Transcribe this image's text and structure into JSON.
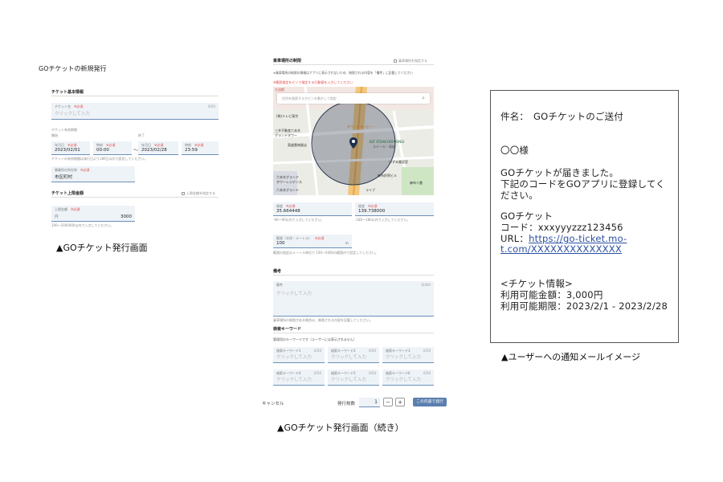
{
  "left": {
    "title": "GOチケットの新規発行",
    "basic_section": "チケット基本情報",
    "ticket_name": {
      "label": "チケット名",
      "required": "※必須",
      "placeholder": "クリックして入力",
      "count": "0/50"
    },
    "period_label": "チケット有効期間",
    "start_label": "開始",
    "end_label": "終了",
    "start_date": {
      "label": "年月日",
      "required": "※必須",
      "value": "2023/02/01"
    },
    "start_time": {
      "label": "時刻",
      "required": "※必須",
      "value": "00:00"
    },
    "tilde": "〜",
    "end_date": {
      "label": "年月日",
      "required": "※必須",
      "value": "2023/02/28"
    },
    "end_time": {
      "label": "時刻",
      "required": "※必須",
      "value": "23:59"
    },
    "period_hint": "チケットの有効期間は発行日より180日以内で設定してください。",
    "municipality": {
      "label": "事業所の所在地",
      "required": "※必須",
      "value": "市区町村"
    },
    "limit_section": "チケット上限金額",
    "limit_link": "上限金額を指定する",
    "limit_amount": {
      "label": "上限金額",
      "required": "※必須",
      "unit": "円",
      "value": "3000"
    },
    "limit_hint": "100〜1000000以内で入力してください。",
    "caption": "▲GOチケット発行画面"
  },
  "middle": {
    "area_section": "乗車場所の制限",
    "area_link": "乗車場所を指定する",
    "area_note": "※乗車場所の制限の情報はアプリに表示されないため、制限される内容を「備考」に記載してください",
    "map_hint": "※範囲指定をピンで指定する行動値を入力してください",
    "map_search_placeholder": "住所を検索するかピンを動かして指定",
    "map_labels": [
      "(株)テレビ東京",
      "タリーズコーヒー",
      "三井不動産六本木",
      "グランドタワー",
      "東盛雲南飯店",
      "BLT STEAK ROPPONGI",
      "ステーキ・高級",
      "六本木グランド",
      "タワーレジデンス",
      "いずみ美容室",
      "麻布十番",
      "麻布鈴寄ビル",
      "ライブ",
      "六本木グランド"
    ],
    "map_brand": "大治郎",
    "latitude": {
      "label": "緯度",
      "required": "※必須",
      "value": "35.664448"
    },
    "longitude": {
      "label": "経度",
      "required": "※必須",
      "value": "139.738000"
    },
    "lat_hint": "-90〜90以内で入力してください。",
    "lng_hint": "-180〜180以内で入力してください。",
    "radius": {
      "label": "範囲（半径・メートル）",
      "required": "※必須",
      "value": "100",
      "unit": "m"
    },
    "radius_hint": "範囲の指定はメートル単位で 100〜5000の範囲内で設定してください。",
    "remarks_section": "備考",
    "remarks": {
      "label": "備考",
      "placeholder": "クリックして入力",
      "count": "0/400"
    },
    "remarks_hint": "乗車場所の制限がある場合は、制限される内容を記載してください。",
    "keyword_section": "検索キーワード",
    "keyword_note": "管理用のキーワードです（ユーザーには表示されません）",
    "keywords": [
      {
        "label": "検索キーワード1",
        "count": "0/50",
        "placeholder": "クリックして入力"
      },
      {
        "label": "検索キーワード2",
        "count": "0/50",
        "placeholder": "クリックして入力"
      },
      {
        "label": "検索キーワード3",
        "count": "0/50",
        "placeholder": "クリックして入力"
      },
      {
        "label": "検索キーワード4",
        "count": "0/50",
        "placeholder": "クリックして入力"
      },
      {
        "label": "検索キーワード5",
        "count": "0/50",
        "placeholder": "クリックして入力"
      },
      {
        "label": "検索キーワード6",
        "count": "0/50",
        "placeholder": "クリックして入力"
      }
    ],
    "cancel": "キャンセル",
    "issue_count_label": "発行枚数",
    "issue_count": "1",
    "minus": "−",
    "plus": "+",
    "submit": "この内容で発行",
    "caption": "▲GOチケット発行画面（続き）"
  },
  "mail": {
    "subject": "件名：　GOチケットのご送付",
    "greeting": "〇〇様",
    "body1": "GOチケットが届きました。",
    "body2": "下記のコードをGOアプリに登録してく",
    "body3": "ださい。",
    "ticket": "GOチケット",
    "code": "コード：xxxyyyzzz123456",
    "url_label": "URL：",
    "url1": "https://go-ticket.mo-",
    "url2": "t.com/XXXXXXXXXXXXXX",
    "info": "<チケット情報>",
    "amount": "利用可能金額：3,000円",
    "period": "利用可能期限：2023/2/1 - 2023/2/28",
    "caption": "▲ユーザーへの通知メールイメージ"
  },
  "colors": {
    "accent": "#5b7fb0",
    "required": "#e04a4a",
    "field_bg": "#eef3f8"
  }
}
